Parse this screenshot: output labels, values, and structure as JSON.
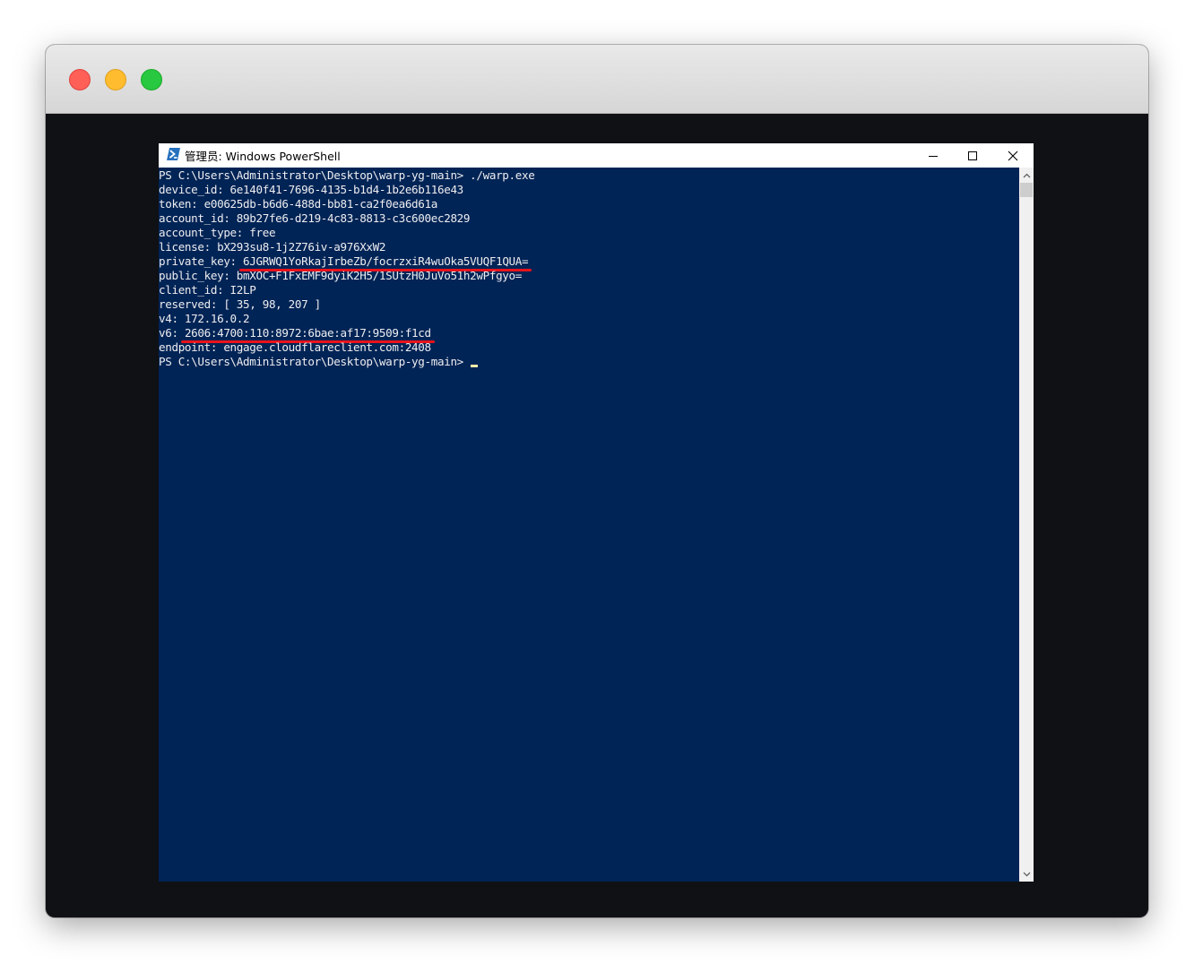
{
  "window": {
    "title": "管理员: Windows PowerShell"
  },
  "console": {
    "line0": "PS C:\\Users\\Administrator\\Desktop\\warp-yg-main> ./warp.exe",
    "line1": "device_id: 6e140f41-7696-4135-b1d4-1b2e6b116e43",
    "line2": "token: e00625db-b6d6-488d-bb81-ca2f0ea6d61a",
    "line3": "account_id: 89b27fe6-d219-4c83-8813-c3c600ec2829",
    "line4": "account_type: free",
    "line5": "license: bX293su8-1j2Z76iv-a976XxW2",
    "line6_label": "private_key: ",
    "line6_value": "6JGRWQ1YoRkajIrbeZb/focrzxiR4wuOka5VUQF1QUA=",
    "line7": "public_key: bmXOC+F1FxEMF9dyiK2H5/1SUtzH0JuVo51h2wPfgyo=",
    "line8": "client_id: I2LP",
    "line9": "reserved: [ 35, 98, 207 ]",
    "line10": "v4: 172.16.0.2",
    "line11_label": "v6: ",
    "line11_value": "2606:4700:110:8972:6bae:af17:9509:f1cd",
    "line12": "endpoint: engage.cloudflareclient.com:2408",
    "line13": "PS C:\\Users\\Administrator\\Desktop\\warp-yg-main>"
  },
  "colors": {
    "console_background": "#012456",
    "console_text": "#eeedf0",
    "highlight_underline": "#e8131b",
    "cursor": "#ffe9a9"
  }
}
